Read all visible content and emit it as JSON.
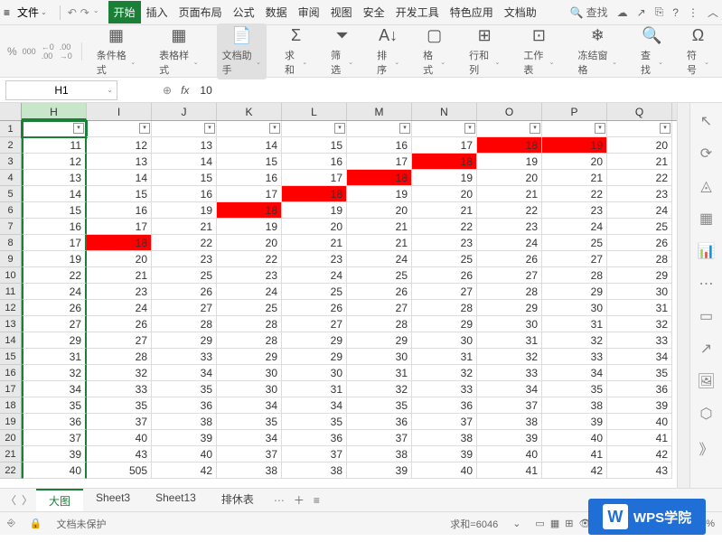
{
  "menubar": {
    "file": "文件",
    "tabs": [
      "开始",
      "插入",
      "页面布局",
      "公式",
      "数据",
      "审阅",
      "视图",
      "安全",
      "开发工具",
      "特色应用",
      "文档助"
    ],
    "active_tab": 0,
    "search": "查找"
  },
  "ribbon": {
    "percent_icon": "%",
    "comma_icon": "000",
    "dec_inc": "←0\n.00",
    "dec_dec": ".00\n→0",
    "buttons": [
      {
        "label": "条件格式",
        "icon": "grid"
      },
      {
        "label": "表格样式",
        "icon": "grid"
      },
      {
        "label": "文档助手",
        "icon": "doc",
        "active": true
      },
      {
        "label": "求和",
        "icon": "sigma"
      },
      {
        "label": "筛选",
        "icon": "funnel"
      },
      {
        "label": "排序",
        "icon": "sort"
      },
      {
        "label": "格式",
        "icon": "cell"
      },
      {
        "label": "行和列",
        "icon": "rowcol"
      },
      {
        "label": "工作表",
        "icon": "sheet"
      },
      {
        "label": "冻结窗格",
        "icon": "freeze"
      },
      {
        "label": "查找",
        "icon": "search"
      },
      {
        "label": "符号",
        "icon": "omega"
      }
    ]
  },
  "formula": {
    "name_box": "H1",
    "fx": "fx",
    "value": "10"
  },
  "columns": [
    "H",
    "I",
    "J",
    "K",
    "L",
    "M",
    "N",
    "O",
    "P",
    "Q"
  ],
  "selected_col": 0,
  "row_headers": [
    1,
    2,
    3,
    4,
    5,
    6,
    7,
    8,
    9,
    10,
    11,
    12,
    13,
    14,
    15,
    16,
    17,
    18,
    19,
    20,
    21,
    22
  ],
  "cells": [
    [
      "",
      "",
      "",
      "",
      "",
      "",
      "",
      "",
      "",
      ""
    ],
    [
      "11",
      "12",
      "13",
      "14",
      "15",
      "16",
      "17",
      "18",
      "19",
      "20"
    ],
    [
      "12",
      "13",
      "14",
      "15",
      "16",
      "17",
      "18",
      "19",
      "20",
      "21"
    ],
    [
      "13",
      "14",
      "15",
      "16",
      "17",
      "18",
      "19",
      "20",
      "21",
      "22"
    ],
    [
      "14",
      "15",
      "16",
      "17",
      "18",
      "19",
      "20",
      "21",
      "22",
      "23"
    ],
    [
      "15",
      "16",
      "19",
      "18",
      "19",
      "20",
      "21",
      "22",
      "23",
      "24"
    ],
    [
      "16",
      "17",
      "21",
      "19",
      "20",
      "21",
      "22",
      "23",
      "24",
      "25"
    ],
    [
      "17",
      "18",
      "22",
      "20",
      "21",
      "21",
      "23",
      "24",
      "25",
      "26"
    ],
    [
      "19",
      "20",
      "23",
      "22",
      "23",
      "24",
      "25",
      "26",
      "27",
      "28"
    ],
    [
      "22",
      "21",
      "25",
      "23",
      "24",
      "25",
      "26",
      "27",
      "28",
      "29"
    ],
    [
      "24",
      "23",
      "26",
      "24",
      "25",
      "26",
      "27",
      "28",
      "29",
      "30"
    ],
    [
      "26",
      "24",
      "27",
      "25",
      "26",
      "27",
      "28",
      "29",
      "30",
      "31"
    ],
    [
      "27",
      "26",
      "28",
      "28",
      "27",
      "28",
      "29",
      "30",
      "31",
      "32"
    ],
    [
      "29",
      "27",
      "29",
      "28",
      "29",
      "29",
      "30",
      "31",
      "32",
      "33"
    ],
    [
      "31",
      "28",
      "33",
      "29",
      "29",
      "30",
      "31",
      "32",
      "33",
      "34"
    ],
    [
      "32",
      "32",
      "34",
      "30",
      "30",
      "31",
      "32",
      "33",
      "34",
      "35"
    ],
    [
      "34",
      "33",
      "35",
      "30",
      "31",
      "32",
      "33",
      "34",
      "35",
      "36"
    ],
    [
      "35",
      "35",
      "36",
      "34",
      "34",
      "35",
      "36",
      "37",
      "38",
      "39"
    ],
    [
      "36",
      "37",
      "38",
      "35",
      "35",
      "36",
      "37",
      "38",
      "39",
      "40"
    ],
    [
      "37",
      "40",
      "39",
      "34",
      "36",
      "37",
      "38",
      "39",
      "40",
      "41"
    ],
    [
      "39",
      "43",
      "40",
      "37",
      "37",
      "38",
      "39",
      "40",
      "41",
      "42"
    ],
    [
      "40",
      "505",
      "42",
      "38",
      "38",
      "39",
      "40",
      "41",
      "42",
      "43"
    ]
  ],
  "red_cells": {
    "1-7": true,
    "1-8": true,
    "2-6": true,
    "3-5": true,
    "4-4": true,
    "5-3": true,
    "7-1": true
  },
  "filter_row": 0,
  "sheet_tabs": {
    "items": [
      "大图",
      "Sheet3",
      "Sheet13",
      "排休表"
    ],
    "active": 0
  },
  "statusbar": {
    "protect": "文档未保护",
    "sum": "求和=6046",
    "zoom": "100%"
  },
  "logo": "WPS学院"
}
